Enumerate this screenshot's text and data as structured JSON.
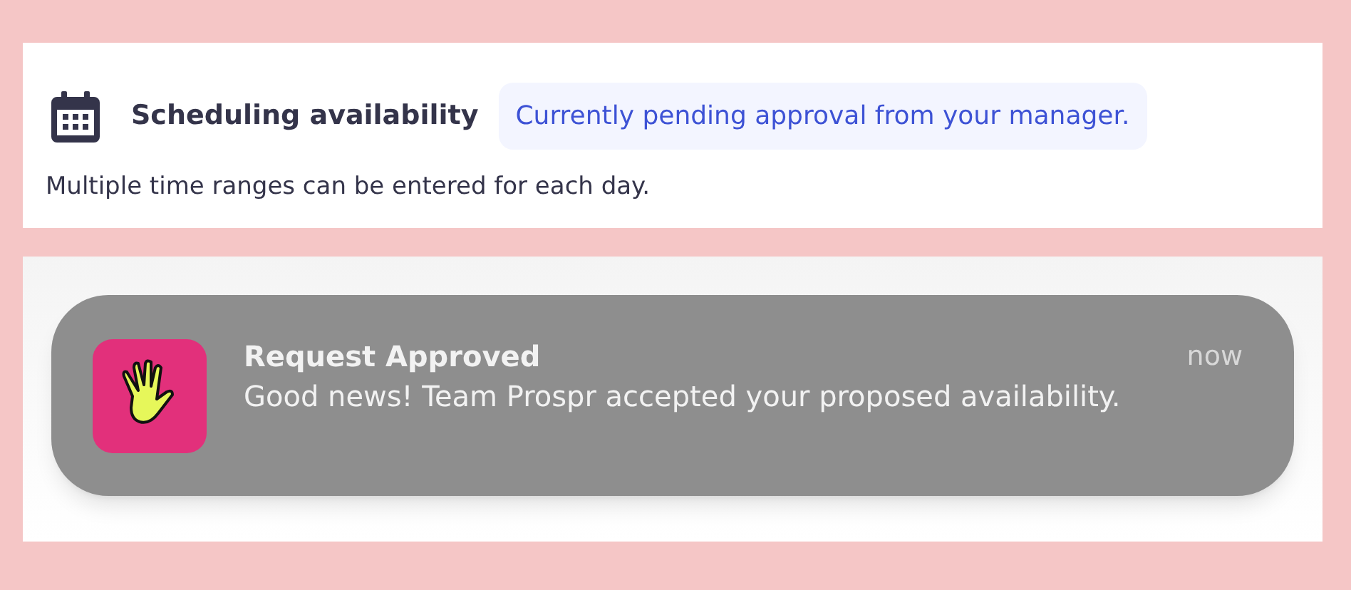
{
  "availability": {
    "title": "Scheduling availability",
    "status_badge": "Currently pending approval from your manager.",
    "hint": "Multiple time ranges can be entered for each day."
  },
  "notification": {
    "title": "Request Approved",
    "message": "Good news! Team Prospr accepted your proposed availability.",
    "time": "now"
  }
}
